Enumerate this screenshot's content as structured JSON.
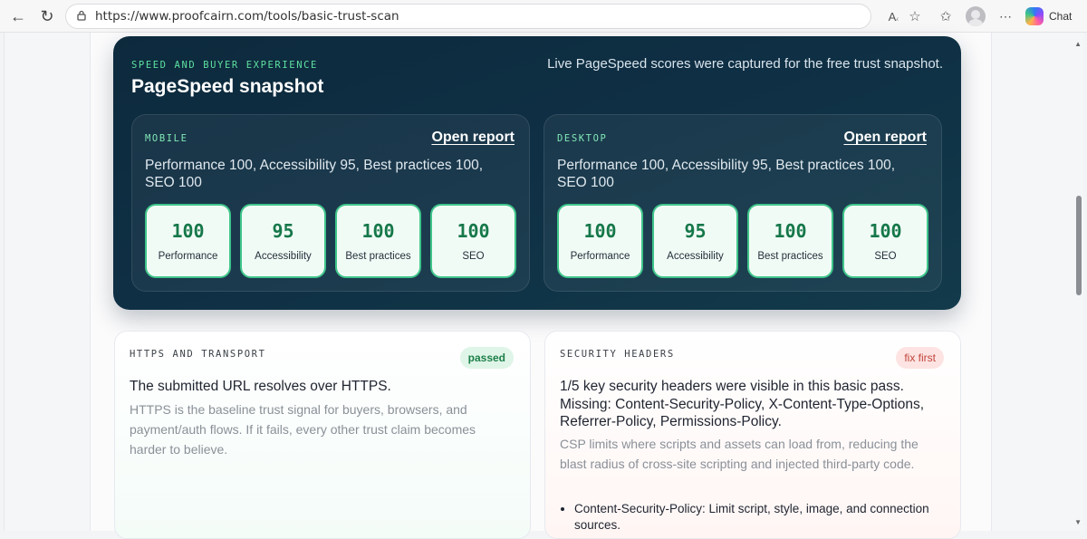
{
  "browser": {
    "url": "https://www.proofcairn.com/tools/basic-trust-scan",
    "chat_label": "Chat"
  },
  "pagespeed": {
    "kicker": "SPEED AND BUYER EXPERIENCE",
    "title": "PageSpeed snapshot",
    "note": "Live PageSpeed scores were captured for the free trust snapshot.",
    "mobile": {
      "label": "MOBILE",
      "open_report": "Open report",
      "summary": "Performance 100, Accessibility 95, Best practices 100, SEO 100",
      "scores": [
        {
          "value": "100",
          "label": "Performance"
        },
        {
          "value": "95",
          "label": "Accessibility"
        },
        {
          "value": "100",
          "label": "Best practices"
        },
        {
          "value": "100",
          "label": "SEO"
        }
      ]
    },
    "desktop": {
      "label": "DESKTOP",
      "open_report": "Open report",
      "summary": "Performance 100, Accessibility 95, Best practices 100, SEO 100",
      "scores": [
        {
          "value": "100",
          "label": "Performance"
        },
        {
          "value": "95",
          "label": "Accessibility"
        },
        {
          "value": "100",
          "label": "Best practices"
        },
        {
          "value": "100",
          "label": "SEO"
        }
      ]
    }
  },
  "https_card": {
    "kicker": "HTTPS AND TRANSPORT",
    "badge": "passed",
    "headline": "The submitted URL resolves over HTTPS.",
    "body": "HTTPS is the baseline trust signal for buyers, browsers, and payment/auth flows. If it fails, every other trust claim becomes harder to believe."
  },
  "headers_card": {
    "kicker": "SECURITY HEADERS",
    "badge": "fix first",
    "headline": "1/5 key security headers were visible in this basic pass. Missing: Content-Security-Policy, X-Content-Type-Options, Referrer-Policy, Permissions-Policy.",
    "body": "CSP limits where scripts and assets can load from, reducing the blast radius of cross-site scripting and injected third-party code.",
    "items": [
      "Content-Security-Policy: Limit script, style, image, and connection sources."
    ]
  },
  "colors": {
    "panel_bg": "#0f2f44",
    "accent_green": "#3fc58a",
    "pass_badge": "#1d7f48",
    "fix_badge": "#c0443a"
  },
  "icons": [
    "back-icon",
    "reload-icon",
    "lock-icon",
    "read-aloud-icon",
    "favorite-star-icon",
    "favorites-list-icon",
    "profile-avatar",
    "more-icon",
    "copilot-icon"
  ]
}
